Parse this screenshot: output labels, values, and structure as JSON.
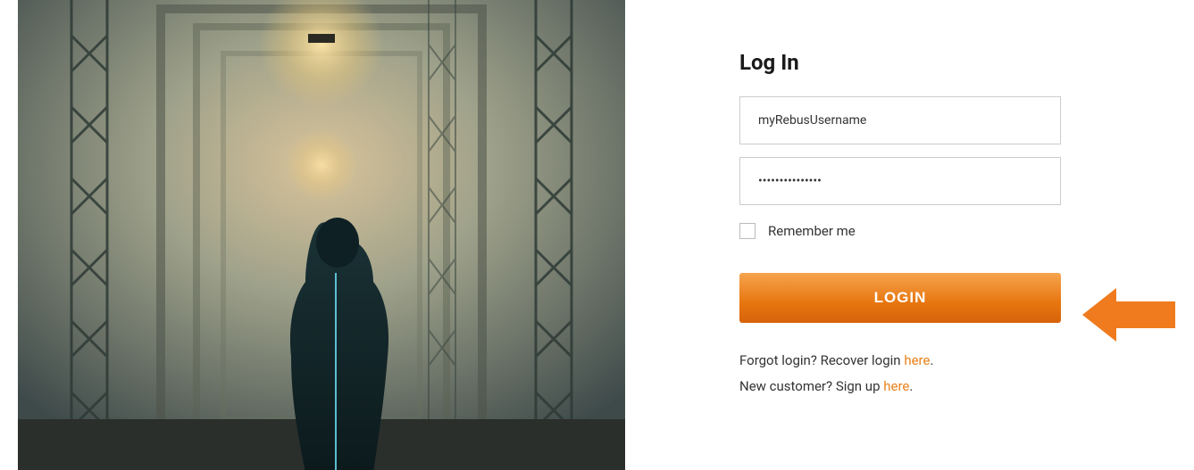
{
  "login": {
    "title": "Log In",
    "username_value": "myRebusUsername",
    "password_value": "•••••••••••••••",
    "remember_label": "Remember me",
    "button_label": "LOGIN",
    "forgot_prefix": "Forgot login? Recover login ",
    "forgot_link": "here",
    "forgot_suffix": ".",
    "signup_prefix": "New customer? Sign up ",
    "signup_link": "here",
    "signup_suffix": "."
  },
  "colors": {
    "accent": "#e8811a",
    "arrow": "#ef7b1e"
  }
}
